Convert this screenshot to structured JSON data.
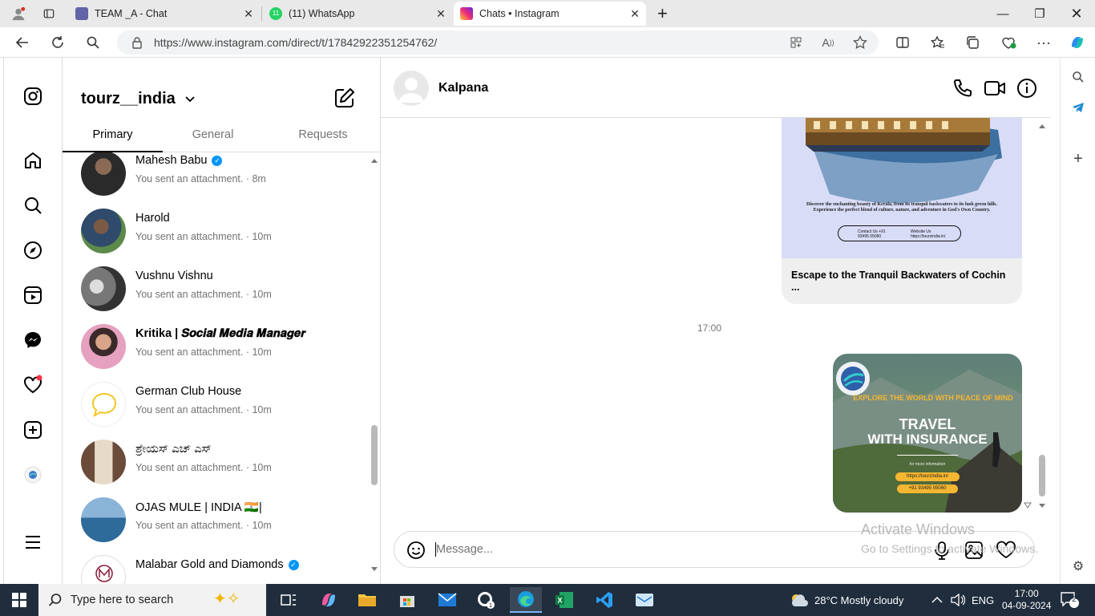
{
  "browser": {
    "tabs": [
      {
        "title": "TEAM _A - Chat",
        "active": false
      },
      {
        "title": "(11) WhatsApp",
        "active": false
      },
      {
        "title": "Chats • Instagram",
        "active": true
      }
    ],
    "url": "https://www.instagram.com/direct/t/17842922351254762/",
    "whatsapp_badge": "11"
  },
  "inbox": {
    "account": "tourz__india",
    "tabs": [
      "Primary",
      "General",
      "Requests"
    ],
    "conversations": [
      {
        "name": "Mahesh Babu",
        "verified": true,
        "preview": "You sent an attachment. · 8m",
        "bold": false
      },
      {
        "name": "Harold",
        "verified": false,
        "preview": "You sent an attachment. · 10m",
        "bold": false
      },
      {
        "name": "Vushnu Vishnu",
        "verified": false,
        "preview": "You sent an attachment. · 10m",
        "bold": false
      },
      {
        "name": "Kritika | 𝑺𝒐𝒄𝒊𝒂𝒍 𝑴𝒆𝒅𝒊𝒂 𝑴𝒂𝒏𝒂𝒈𝒆𝒓",
        "verified": false,
        "preview": "You sent an attachment. · 10m",
        "bold": true
      },
      {
        "name": "German Club House",
        "verified": false,
        "preview": "You sent an attachment. · 10m",
        "bold": false
      },
      {
        "name": "ಶ್ರೇಯಸ್ ಎಚ್ ಎಸ್",
        "verified": false,
        "preview": "You sent an attachment. · 10m",
        "bold": false
      },
      {
        "name": "OJAS MULE | INDIA 🇮🇳|",
        "verified": false,
        "preview": "You sent an attachment. · 10m",
        "bold": false
      },
      {
        "name": "Malabar Gold and Diamonds",
        "verified": true,
        "preview": "",
        "bold": false
      }
    ]
  },
  "chat": {
    "contact_name": "Kalpana",
    "card_caption": "Escape to the Tranquil Backwaters of Cochin ...",
    "card_image_text": "Discover the enchanting beauty of Kerala, from its tranquil backwaters to its lush green hills. Experience the perfect blend of culture, nature, and adventure in God's Own Country.",
    "card_contact": "Contact Us +91 93495 05060",
    "card_website": "Website Us https://tourzindia.in/",
    "timestamp": "17:00",
    "insurance_image": {
      "tagline": "EXPLORE THE WORLD WITH PEACE OF MIND",
      "title_line1": "TRAVEL",
      "title_line2": "WITH INSURANCE",
      "more_info": "for more information",
      "website": "https://tourzindia.in/",
      "phone": "+91 93495 05060"
    },
    "composer_placeholder": "Message..."
  },
  "watermark": {
    "line1": "Activate Windows",
    "line2": "Go to Settings to activate Windows."
  },
  "taskbar": {
    "search_placeholder": "Type here to search",
    "weather": "28°C  Mostly cloudy",
    "language": "ENG",
    "time": "17:00",
    "date": "04-09-2024",
    "notifications": "2"
  }
}
